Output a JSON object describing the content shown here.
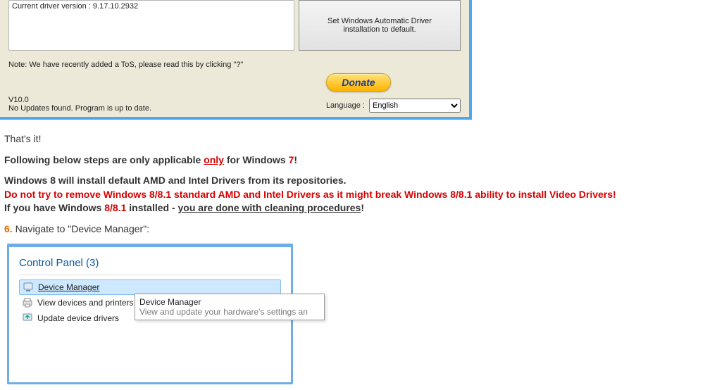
{
  "app": {
    "driver_version_text": "Current driver version : 9.17.10.2932",
    "set_default_label": "Set Windows Automatic Driver installation to default.",
    "tos_note": "Note: We have recently added a ToS, please read this by clicking \"?\"",
    "version": "V10.0",
    "uptodate": "No Updates found. Program is up to date.",
    "donate_label": "Donate",
    "language_label": "Language :",
    "language_value": "English"
  },
  "article": {
    "thats_it": "That's it!",
    "following_prefix": "Following below steps are only applicable ",
    "only_word": "only",
    "following_mid": " for Windows ",
    "seven": "7",
    "following_suffix": "!",
    "win8_line1": "Windows 8 will install default AMD and Intel Drivers from its repositories.",
    "win8_warning": "Do not try to remove Windows 8/8.1 standard AMD and Intel Drivers as it might break Windows 8/8.1 ability to install Video Drivers!",
    "if_prefix": "If you have Windows ",
    "eight": "8/8.1",
    "if_mid": " installed - ",
    "done_text": "you are done with cleaning procedures",
    "if_suffix": "!",
    "step6_num": "6.",
    "step6_text": " Navigate to \"Device Manager\":"
  },
  "cp": {
    "header": "Control Panel (3)",
    "items": [
      {
        "label": "Device Manager"
      },
      {
        "label": "View devices and printers"
      },
      {
        "label": "Update device drivers"
      }
    ],
    "tooltip_title": "Device Manager",
    "tooltip_desc": "View and update your hardware's settings an"
  }
}
